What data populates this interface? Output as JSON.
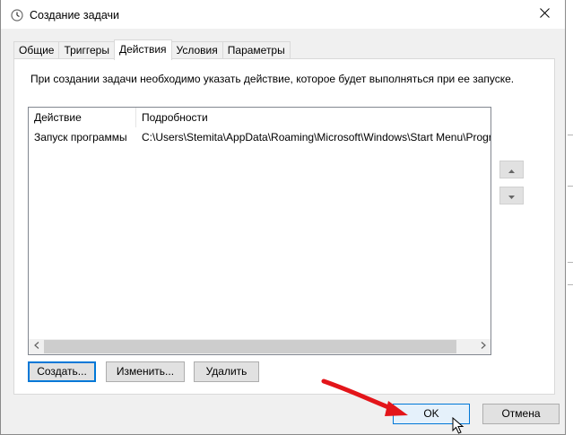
{
  "window": {
    "title": "Создание задачи",
    "close_symbol": "✕"
  },
  "tabs": [
    {
      "label": "Общие"
    },
    {
      "label": "Триггеры"
    },
    {
      "label": "Действия",
      "active": true
    },
    {
      "label": "Условия"
    },
    {
      "label": "Параметры"
    }
  ],
  "panel": {
    "hint": "При создании задачи необходимо указать действие, которое будет выполняться при ее запуске."
  },
  "actions_list": {
    "columns": [
      "Действие",
      "Подробности"
    ],
    "rows": [
      {
        "action": "Запуск программы",
        "details": "C:\\Users\\Stemita\\AppData\\Roaming\\Microsoft\\Windows\\Start Menu\\Programs"
      }
    ]
  },
  "list_buttons": {
    "create": "Создать...",
    "edit": "Изменить...",
    "delete": "Удалить"
  },
  "footer": {
    "ok": "OK",
    "cancel": "Отмена"
  },
  "colors": {
    "accent": "#0078d7",
    "annotation_arrow": "#e3151a"
  }
}
